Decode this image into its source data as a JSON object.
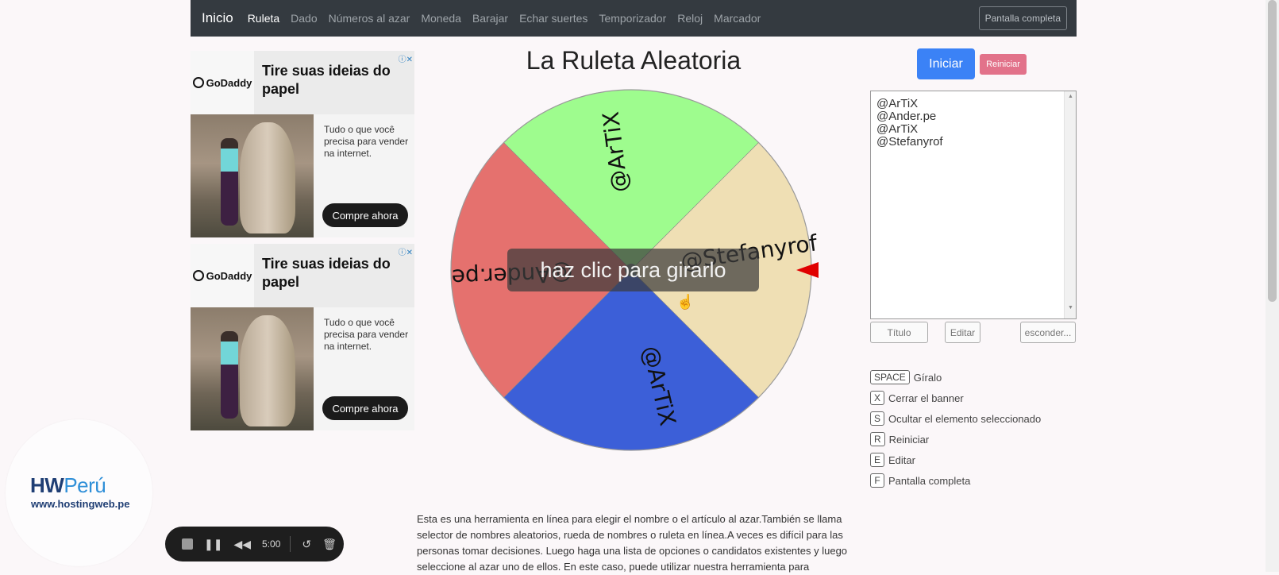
{
  "navbar": {
    "brand": "Inicio",
    "links": [
      "Ruleta",
      "Dado",
      "Números al azar",
      "Moneda",
      "Barajar",
      "Echar suertes",
      "Temporizador",
      "Reloj",
      "Marcador"
    ],
    "active": "Ruleta",
    "fullscreen_label": "Pantalla completa"
  },
  "ads": [
    {
      "brand": "GoDaddy",
      "headline": "Tire suas ideias do papel",
      "text": "Tudo o que você precisa para vender na internet.",
      "cta": "Compre ahora",
      "close": "ⓘ✕"
    },
    {
      "brand": "GoDaddy",
      "headline": "Tire suas ideias do papel",
      "text": "Tudo o que você precisa para vender na internet.",
      "cta": "Compre ahora",
      "close": "ⓘ✕"
    }
  ],
  "title": "La Ruleta Aleatoria",
  "wheel": {
    "segments": [
      {
        "label": "@ArTiX",
        "color": "#9efc8e"
      },
      {
        "label": "@Stefanyrof",
        "color": "#efdfb4"
      },
      {
        "label": "@ArTiX",
        "color": "#3c5fd8"
      },
      {
        "label": "@Ander.pe",
        "color": "#e5716e"
      }
    ],
    "overlay_text": "haz clic para girarlo",
    "pointer_color": "#e00000"
  },
  "controls": {
    "start_label": "Iniciar",
    "reset_label": "Reiniciar"
  },
  "names_text": [
    "@ArTiX",
    "@Ander.pe",
    "@ArTiX",
    "@Stefanyrof"
  ],
  "buttons": {
    "title": "Título",
    "edit": "Editar",
    "hide": "esconder..."
  },
  "shortcuts": [
    {
      "key": "SPACE",
      "label": "Gíralo"
    },
    {
      "key": "X",
      "label": "Cerrar el banner"
    },
    {
      "key": "S",
      "label": "Ocultar el elemento seleccionado"
    },
    {
      "key": "R",
      "label": "Reiniciar"
    },
    {
      "key": "E",
      "label": "Editar"
    },
    {
      "key": "F",
      "label": "Pantalla completa"
    }
  ],
  "description": "Esta es una herramienta en línea para elegir el nombre o el artículo al azar.También se llama selector de nombres aleatorios, rueda de nombres o ruleta en línea.A veces es difícil para las personas tomar decisiones. Luego haga una lista de opciones o candidatos existentes y luego seleccione al azar uno de ellos. En este caso, puede utilizar nuestra herramienta para",
  "hw_logo": {
    "hw": "HW",
    "peru": "Perú",
    "url": "www.hostingweb.pe"
  },
  "recorder": {
    "time": "5:00"
  }
}
